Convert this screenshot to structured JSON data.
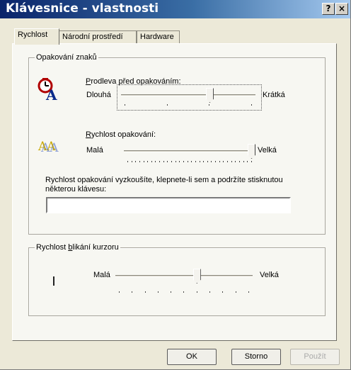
{
  "window": {
    "title": "Klávesnice - vlastnosti",
    "help_btn": "?",
    "close_btn": "×"
  },
  "tabs": [
    {
      "label": "Rychlost",
      "active": true
    },
    {
      "label": "Národní prostředí",
      "active": false
    },
    {
      "label": "Hardware",
      "active": false
    }
  ],
  "repeat_group": {
    "title": "Opakování znaků",
    "delay": {
      "label_first": "P",
      "label_rest": "rodleva před opakováním:",
      "min_label": "Dlouhá",
      "max_label": "Krátká",
      "value_fraction": 0.67,
      "ticks": 4
    },
    "rate": {
      "label_first": "R",
      "label_rest": "ychlost opakování:",
      "min_label": "Malá",
      "max_label": "Velká",
      "value_fraction": 1.0,
      "ticks": 32
    },
    "test_prompt": "Rychlost opakování vyzkoušíte, klepnete-li sem a podržíte stisknutou některou klávesu:",
    "test_value": ""
  },
  "cursor_group": {
    "title_before": "Rychlost ",
    "title_mnemonic": "b",
    "title_after": "likání kurzoru",
    "min_label": "Malá",
    "max_label": "Velká",
    "value_fraction": 0.6,
    "ticks": 11
  },
  "buttons": {
    "ok": "OK",
    "cancel": "Storno",
    "apply": "Použít"
  },
  "icon_text": {
    "delay_glyph": "A",
    "rate_glyph": "AA"
  }
}
